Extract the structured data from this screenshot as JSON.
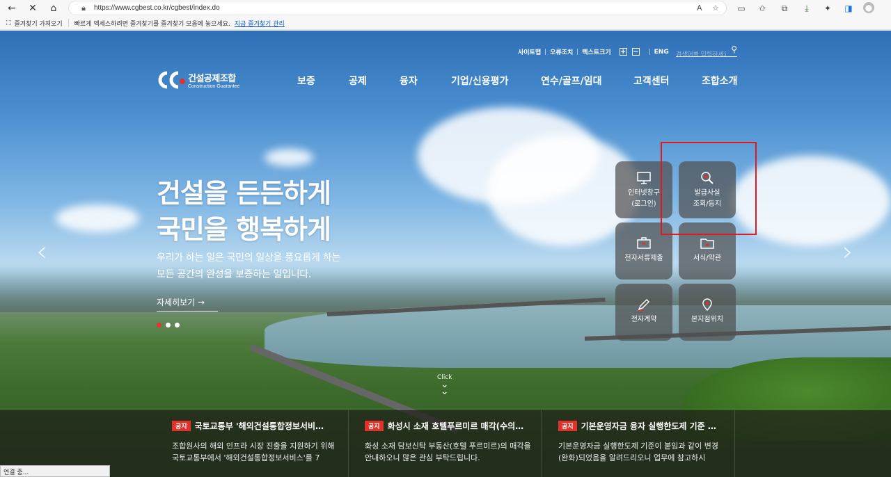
{
  "browser": {
    "url": "https://www.cgbest.co.kr/cgbest/index.do",
    "favorites": {
      "import_label": "즐겨찾기 가져오기",
      "hint": "빠르게 액세스하려면 즐겨찾기를 즐겨찾기 모음에 놓으세요.",
      "manage_link": "지금 즐겨찾기 관리"
    },
    "status": "연결 중..."
  },
  "util_links": [
    "사이트맵",
    "오류조치",
    "텍스트크기",
    "ENG"
  ],
  "search": {
    "placeholder": "검색어를 입력하세요"
  },
  "logo": {
    "ko": "건설공제조합",
    "en": "Construction Guarantee"
  },
  "gnb": [
    "보증",
    "공제",
    "융자",
    "기업/신용평가",
    "연수/골프/임대",
    "고객센터",
    "조합소개"
  ],
  "hero": {
    "headline1": "건설을 든든하게",
    "headline2": "국민을 행복하게",
    "desc1": "우리가 하는 일은 국민의 일상을 풍요롭게 하는",
    "desc2": "모든 공간의 완성을 보증하는 일입니다.",
    "more": "자세히보기"
  },
  "quick": [
    {
      "line1": "인터넷창구",
      "line2": "(로그인)",
      "icon": "monitor-icon"
    },
    {
      "line1": "발급사실",
      "line2": "조회/등지",
      "icon": "search-doc-icon"
    },
    {
      "line1": "전자서류제출",
      "line2": "",
      "icon": "briefcase-icon"
    },
    {
      "line1": "서식/약관",
      "line2": "",
      "icon": "folder-icon"
    },
    {
      "line1": "전자계약",
      "line2": "",
      "icon": "pen-icon"
    },
    {
      "line1": "본지점위치",
      "line2": "",
      "icon": "location-icon"
    }
  ],
  "scroll_label": "Click",
  "news": [
    {
      "badge": "공지",
      "title": "국토교통부 '해외건설통합정보서비…",
      "body": "조합원사의 해외 인프라 시장 진출을 지원하기 위해 국토교통부에서 '해외건설통합정보서비스'를 7"
    },
    {
      "badge": "공지",
      "title": "화성시 소재 호텔푸르미르 매각(수의…",
      "body": "화성 소재 담보신탁 부동산(호텔 푸르미르)의 매각을 안내하오니 많은 관심 부탁드립니다."
    },
    {
      "badge": "공지",
      "title": "기본운영자금 융자 실행한도제 기준 …",
      "body": "기본운영자금 실행한도제 기준이 붙임과 같이 변경(완화)되었음을 알려드리오니 업무에 참고하시"
    }
  ],
  "colors": {
    "accent": "#e0312a",
    "highlight_box": "#e0191f"
  }
}
